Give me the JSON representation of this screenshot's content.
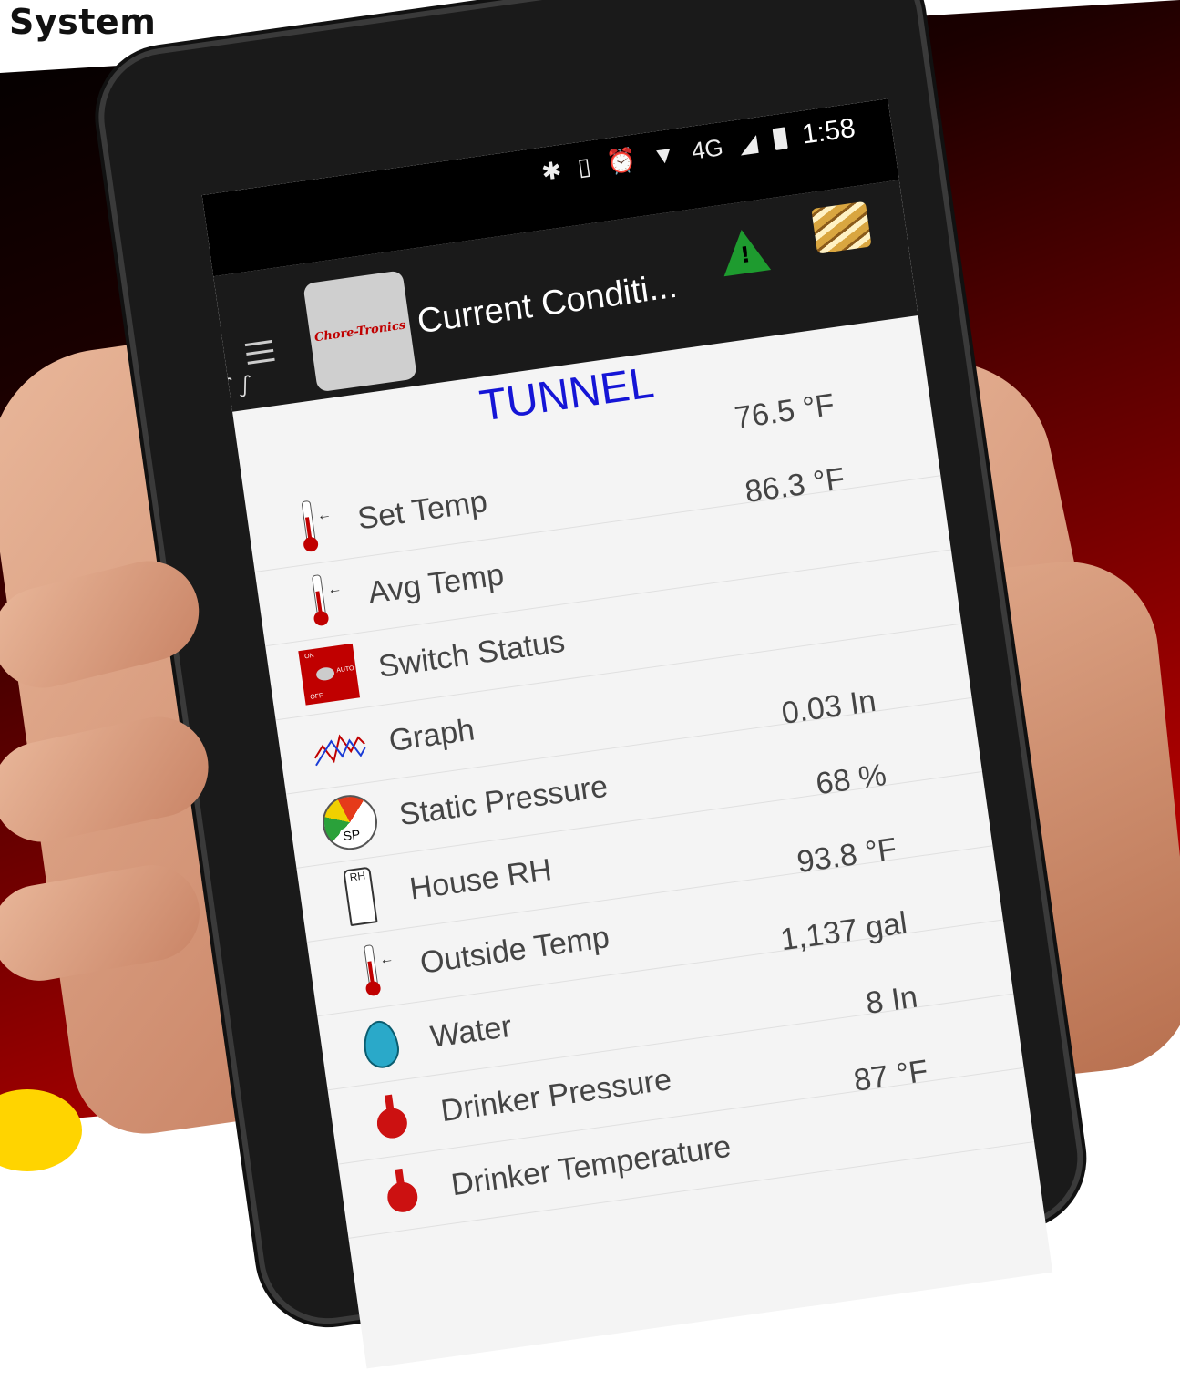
{
  "header": {
    "title": "System"
  },
  "phone": {
    "status_bar": {
      "icons": [
        "bluetooth-icon",
        "vibrate-icon",
        "alarm-icon",
        "wifi-icon",
        "signal-icon",
        "battery-icon"
      ],
      "network": "4G",
      "time": "1:58"
    },
    "app_bar": {
      "logo_text": "Chore-Tronics",
      "title": "Current Conditi...",
      "alert_icon": "warning-icon",
      "barn_icon": "house-icon"
    },
    "section_title": "TUNNEL",
    "rows": [
      {
        "label": "Set Temp",
        "value": "76.5 °F",
        "icon": "thermometer-icon"
      },
      {
        "label": "Avg Temp",
        "value": "86.3 °F",
        "icon": "thermometer-icon"
      },
      {
        "label": "Switch Status",
        "value": "",
        "icon": "switch-icon",
        "switch_labels": [
          "ON",
          "AUTO",
          "OFF"
        ]
      },
      {
        "label": "Graph",
        "value": "",
        "icon": "graph-icon"
      },
      {
        "label": "Static Pressure",
        "value": "0.03 In",
        "icon": "gauge-icon",
        "icon_text": "SP"
      },
      {
        "label": "House RH",
        "value": "68 %",
        "icon": "humidity-icon",
        "icon_text": "RH"
      },
      {
        "label": "Outside Temp",
        "value": "93.8 °F",
        "icon": "thermometer-icon"
      },
      {
        "label": "Water",
        "value": "1,137 gal",
        "icon": "water-drop-icon"
      },
      {
        "label": "Drinker Pressure",
        "value": "8 In",
        "icon": "drinker-icon"
      },
      {
        "label": "Drinker Temperature",
        "value": "87 °F",
        "icon": "drinker-icon"
      }
    ]
  },
  "colors": {
    "section_title": "#1515d6",
    "accent_red": "#c00000",
    "alert_green": "#1e9b2f"
  }
}
